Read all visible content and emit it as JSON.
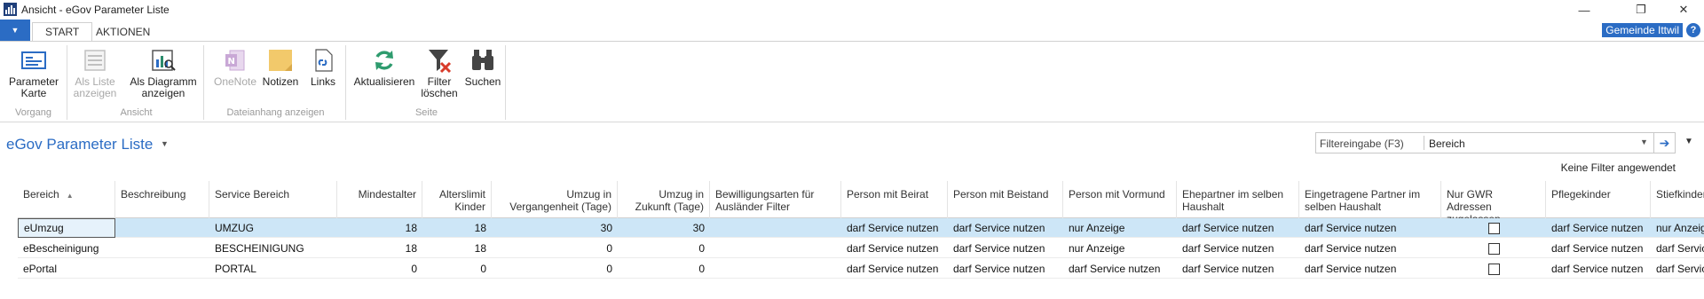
{
  "window": {
    "title": "Ansicht - eGov Parameter Liste",
    "minimize": "—",
    "restore": "❐",
    "close": "✕"
  },
  "tabs": [
    {
      "label": "START",
      "active": true
    },
    {
      "label": "AKTIONEN",
      "active": false
    }
  ],
  "company": "Gemeinde Ittwil",
  "ribbon": {
    "groups": {
      "vorgang": "Vorgang",
      "ansicht": "Ansicht",
      "dateianhang": "Dateianhang anzeigen",
      "seite": "Seite"
    },
    "buttons": {
      "parameter_karte": [
        "Parameter",
        "Karte"
      ],
      "als_liste": [
        "Als Liste",
        "anzeigen"
      ],
      "als_diagramm": [
        "Als Diagramm",
        "anzeigen"
      ],
      "onenote": "OneNote",
      "notizen": "Notizen",
      "links": "Links",
      "aktualisieren": "Aktualisieren",
      "filter_loeschen": [
        "Filter",
        "löschen"
      ],
      "suchen": "Suchen"
    }
  },
  "page": {
    "title": "eGov Parameter Liste"
  },
  "filter": {
    "label": "Filtereingabe (F3)",
    "field": "Bereich",
    "no_filter": "Keine Filter angewendet"
  },
  "table": {
    "headers": {
      "bereich": "Bereich",
      "beschreibung": "Beschreibung",
      "service_bereich": "Service Bereich",
      "mindestalter": "Mindestalter",
      "alterslimit": [
        "Alterslimit",
        "Kinder"
      ],
      "umzug_vergangenheit": [
        "Umzug in",
        "Vergangenheit (Tage)"
      ],
      "umzug_zukunft": [
        "Umzug in",
        "Zukunft (Tage)"
      ],
      "bewilligungsarten": [
        "Bewilligungsarten für",
        "Ausländer Filter"
      ],
      "beirat": "Person mit Beirat",
      "beistand": "Person mit Beistand",
      "vormund": "Person mit Vormund",
      "ehepartner": [
        "Ehepartner im selben",
        "Haushalt"
      ],
      "eingetragene": [
        "Eingetragene Partner im",
        "selben Haushalt"
      ],
      "gwr": [
        "Nur GWR Adressen",
        "zugelassen"
      ],
      "pflegekinder": "Pflegekinder",
      "stiefkinder": "Stiefkinder"
    },
    "rows": [
      {
        "bereich": "eUmzug",
        "beschreibung": "",
        "service_bereich": "UMZUG",
        "mindestalter": "18",
        "alterslimit": "18",
        "umzug_vergangenheit": "30",
        "umzug_zukunft": "30",
        "bewilligungsarten": "",
        "beirat": "darf Service nutzen",
        "beistand": "darf Service nutzen",
        "vormund": "nur Anzeige",
        "ehepartner": "darf Service nutzen",
        "eingetragene": "darf Service nutzen",
        "gwr": false,
        "pflegekinder": "darf Service nutzen",
        "stiefkinder": "nur Anzeige"
      },
      {
        "bereich": "eBescheinigung",
        "beschreibung": "",
        "service_bereich": "BESCHEINIGUNG",
        "mindestalter": "18",
        "alterslimit": "18",
        "umzug_vergangenheit": "0",
        "umzug_zukunft": "0",
        "bewilligungsarten": "",
        "beirat": "darf Service nutzen",
        "beistand": "darf Service nutzen",
        "vormund": "nur Anzeige",
        "ehepartner": "darf Service nutzen",
        "eingetragene": "darf Service nutzen",
        "gwr": false,
        "pflegekinder": "darf Service nutzen",
        "stiefkinder": "darf Service nutzen"
      },
      {
        "bereich": "ePortal",
        "beschreibung": "",
        "service_bereich": "PORTAL",
        "mindestalter": "0",
        "alterslimit": "0",
        "umzug_vergangenheit": "0",
        "umzug_zukunft": "0",
        "bewilligungsarten": "",
        "beirat": "darf Service nutzen",
        "beistand": "darf Service nutzen",
        "vormund": "darf Service nutzen",
        "ehepartner": "darf Service nutzen",
        "eingetragene": "darf Service nutzen",
        "gwr": false,
        "pflegekinder": "darf Service nutzen",
        "stiefkinder": "darf Service nutzen"
      }
    ]
  },
  "colors": {
    "accent": "#2b6cc4",
    "selected_row": "#cde6f7"
  }
}
